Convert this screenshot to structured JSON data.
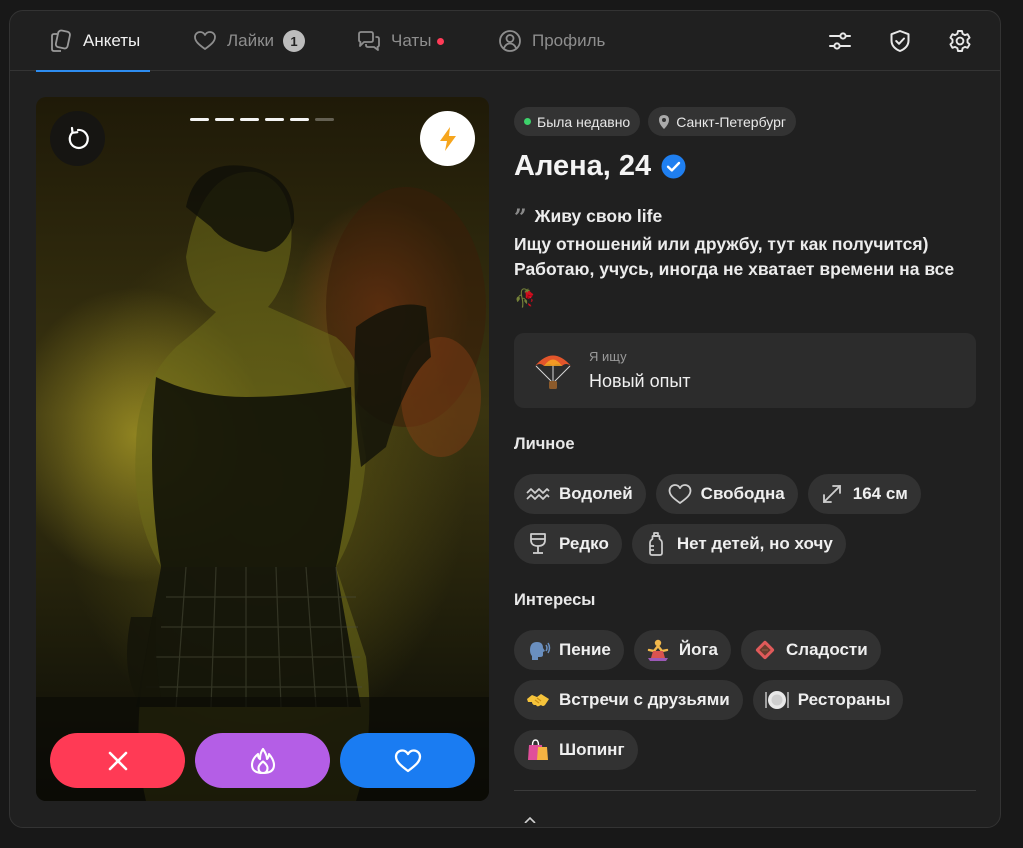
{
  "nav": {
    "tabs": [
      {
        "label": "Анкеты",
        "icon": "cards-icon",
        "active": true
      },
      {
        "label": "Лайки",
        "icon": "heart-icon",
        "badge": "1"
      },
      {
        "label": "Чаты",
        "icon": "chats-icon",
        "has_dot": true
      },
      {
        "label": "Профиль",
        "icon": "profile-icon"
      }
    ],
    "right_icons": [
      "filters-icon",
      "shield-check-icon",
      "settings-gear-icon"
    ]
  },
  "photo": {
    "slides_total": 6,
    "slide_active_count": 5,
    "buttons": [
      "undo-icon",
      "boost-lightning-icon",
      "dislike-x-icon",
      "superlike-fire-icon",
      "like-heart-icon"
    ]
  },
  "profile": {
    "status": "Была недавно",
    "city": "Санкт-Петербург",
    "name_age": "Алена, 24",
    "verified": true,
    "bio_line1": "Живу свою life",
    "bio_line2": "Ищу отношений или дружбу, тут как получится)",
    "bio_line3": "Работаю, учусь, иногда не хватает времени на все",
    "bio_emoji": "🥀",
    "seeking": {
      "label": "Я ищу",
      "value": "Новый опыт",
      "emoji": "parachute-icon"
    },
    "personal_title": "Личное",
    "personal": [
      {
        "label": "Водолей",
        "icon": "aquarius-icon"
      },
      {
        "label": "Свободна",
        "icon": "heart-outline-icon"
      },
      {
        "label": "164 см",
        "icon": "height-arrows-icon"
      },
      {
        "label": "Редко",
        "icon": "wine-glass-icon"
      },
      {
        "label": "Нет детей, но хочу",
        "icon": "baby-bottle-icon"
      }
    ],
    "interests_title": "Интересы",
    "interests": [
      {
        "label": "Пение",
        "icon": "singing-head-icon"
      },
      {
        "label": "Йога",
        "icon": "yoga-icon"
      },
      {
        "label": "Сладости",
        "icon": "candy-icon"
      },
      {
        "label": "Встречи с друзьями",
        "icon": "handshake-icon"
      },
      {
        "label": "Рестораны",
        "icon": "plate-icon"
      },
      {
        "label": "Шопинг",
        "icon": "shopping-bags-icon"
      }
    ]
  },
  "colors": {
    "accent_blue": "#1a7cf2",
    "dislike_red": "#ff3a55",
    "superlike_purple": "#b45ee6",
    "online_green": "#3dd26b"
  }
}
